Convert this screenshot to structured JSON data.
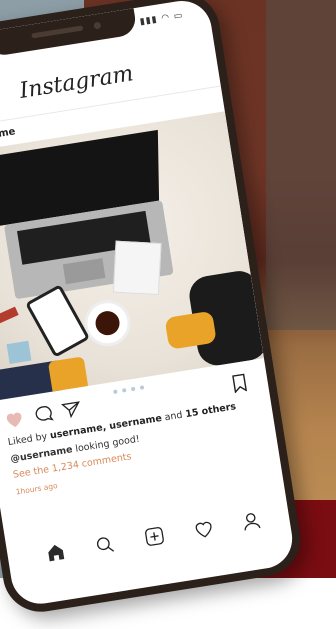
{
  "app": {
    "logo_text": "Instagram"
  },
  "post": {
    "author": "username",
    "liked_by": {
      "prefix": "Liked by ",
      "names": "username, username",
      "middle": " and ",
      "others": "15 others"
    },
    "caption": {
      "user": "@username",
      "text": " looking good!"
    },
    "comments_link": "See the 1,234 comments",
    "timestamp": "1hours ago",
    "carousel_dots": 4
  },
  "icons": {
    "like": "heart-icon",
    "comment": "comment-icon",
    "share": "share-icon",
    "save": "bookmark-icon",
    "home": "home-icon",
    "search": "search-icon",
    "add": "add-post-icon",
    "activity": "heart-outline-icon",
    "profile": "profile-icon"
  },
  "colors": {
    "accent": "#d78a5a",
    "like_filled": "#e9b9b3",
    "phone_frame": "#2b201a"
  }
}
